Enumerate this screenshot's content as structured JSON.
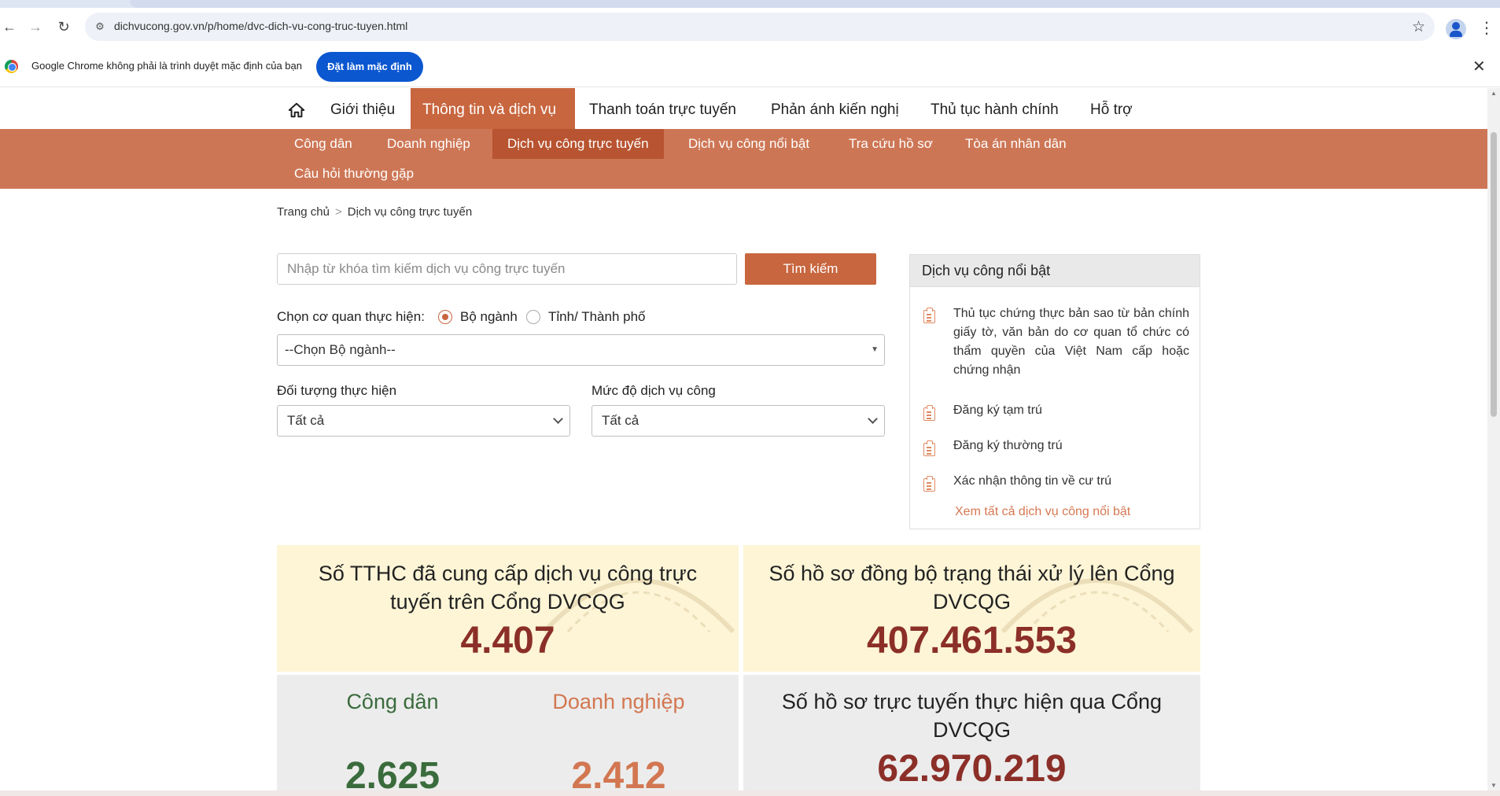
{
  "browser": {
    "url": "dichvucong.gov.vn/p/home/dvc-dich-vu-cong-truc-tuyen.html",
    "infobar_message": "Google Chrome không phải là trình duyệt mặc định của bạn",
    "set_default_label": "Đặt làm mặc định",
    "icons": [
      "back-icon",
      "forward-icon",
      "reload-icon",
      "site-info-icon",
      "star-icon",
      "profile-icon",
      "menu-icon",
      "close-icon"
    ]
  },
  "main_nav": {
    "items": [
      "Giới thiệu",
      "Thông tin và dịch vụ",
      "Thanh toán trực tuyến",
      "Phản ánh kiến nghị",
      "Thủ tục hành chính",
      "Hỗ trợ"
    ],
    "active": "Thông tin và dịch vụ"
  },
  "sub_nav": {
    "items": [
      "Công dân",
      "Doanh nghiệp",
      "Dịch vụ công trực tuyến",
      "Dịch vụ công nổi bật",
      "Tra cứu hồ sơ",
      "Tòa án nhân dân",
      "Câu hỏi thường gặp"
    ],
    "active": "Dịch vụ công trực tuyến"
  },
  "breadcrumb": {
    "home": "Trang chủ",
    "separator": ">",
    "current": "Dịch vụ công trực tuyến"
  },
  "search": {
    "placeholder": "Nhập từ khóa tìm kiếm dịch vụ công trực tuyến",
    "button": "Tìm kiếm"
  },
  "filters": {
    "agency_label": "Chọn cơ quan thực hiện:",
    "agency_options": [
      "Bộ ngành",
      "Tỉnh/ Thành phố"
    ],
    "agency_selected": "Bộ ngành",
    "ministry_select": "--Chọn Bộ ngành--",
    "subject_label": "Đối tượng thực hiện",
    "subject_value": "Tất cả",
    "level_label": "Mức độ dịch vụ công",
    "level_value": "Tất cả"
  },
  "featured": {
    "title": "Dịch vụ công nổi bật",
    "items": [
      "Thủ tục chứng thực bản sao từ bản chính giấy tờ, văn bản do cơ quan tổ chức có thẩm quyền của Việt Nam cấp hoặc chứng nhận",
      "Đăng ký tạm trú",
      "Đăng ký thường trú",
      "Xác nhận thông tin về cư trú"
    ],
    "see_all": "Xem tất cả dịch vụ công nổi bật"
  },
  "stats": {
    "procedures": {
      "title": "Số TTHC đã cung cấp dịch vụ công trực tuyến trên Cổng DVCQG",
      "value": "4.407"
    },
    "synced": {
      "title": "Số hồ sơ đồng bộ trạng thái xử lý lên Cổng DVCQG",
      "value": "407.461.553"
    },
    "citizen": {
      "title": "Công dân",
      "value": "2.625"
    },
    "business": {
      "title": "Doanh nghiệp",
      "value": "2.412"
    },
    "online": {
      "title": "Số hồ sơ trực tuyến thực hiện qua Cổng DVCQG",
      "value": "62.970.219"
    }
  },
  "colors": {
    "brand": "#c8663f",
    "subnav": "#cd7655",
    "number_red": "#8b2f28",
    "citizen_green": "#3a6b3c",
    "business_orange": "#d27751",
    "stat_yellow": "#fdf5d6",
    "stat_grey": "#ececec"
  }
}
